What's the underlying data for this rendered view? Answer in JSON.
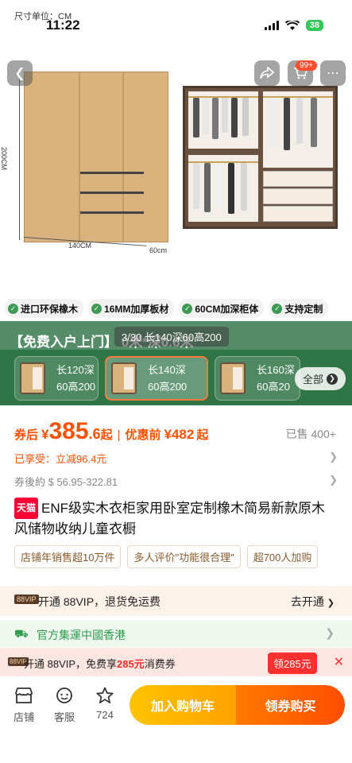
{
  "status_bar": {
    "unit_label": "尺寸单位：CM",
    "time": "11:22",
    "battery": "38"
  },
  "header": {
    "cart_badge": "99+"
  },
  "product_image": {
    "height_label": "200CM",
    "width_label": "140CM",
    "depth_label": "60cm",
    "counter": "3/30 长140深60高200"
  },
  "features": [
    "进口环保橡木",
    "16MM加厚板材",
    "60CM加深柜体",
    "支持定制"
  ],
  "banner": {
    "text": "【免费入户上门】              0米*深0.6米"
  },
  "variants": [
    {
      "line1": "长120深",
      "line2": "60高200"
    },
    {
      "line1": "长140深",
      "line2": "60高200"
    },
    {
      "line1": "长160深",
      "line2": "60高20"
    }
  ],
  "variants_all": "全部",
  "price": {
    "label": "券后",
    "yen": "¥",
    "integer": "385",
    "decimal": ".6",
    "suffix": "起",
    "before_label": "优惠前",
    "before_yen": "¥",
    "before_value": "482",
    "before_suffix": "起",
    "sold": "已售 400+"
  },
  "discount": "已享受：立减96.4元",
  "price_range": "券後約 $ 56.95-322.81",
  "product": {
    "store_badge": "天猫",
    "title": "ENF级实木衣柜家用卧室定制橡木简易新款原木风储物收纳儿童衣橱"
  },
  "selling_tags": [
    "店铺年销售超10万件",
    "多人评价\"功能很合理\"",
    "超700人加购"
  ],
  "vip": {
    "badge": "88VIP",
    "text": "开通 88VIP，退货免运费",
    "link": "去开通"
  },
  "shipping": {
    "text": "官方集運中國香港"
  },
  "coupon_bar": {
    "badge": "88VIP",
    "text_prefix": "开通 88VIP，免费享",
    "amount": "285元",
    "text_suffix": "消费券",
    "button": "领285元"
  },
  "bottom_bar": {
    "store": "店铺",
    "service": "客服",
    "favorites": "724",
    "add_to_cart": "加入购物车",
    "buy_now": "领券购买"
  }
}
